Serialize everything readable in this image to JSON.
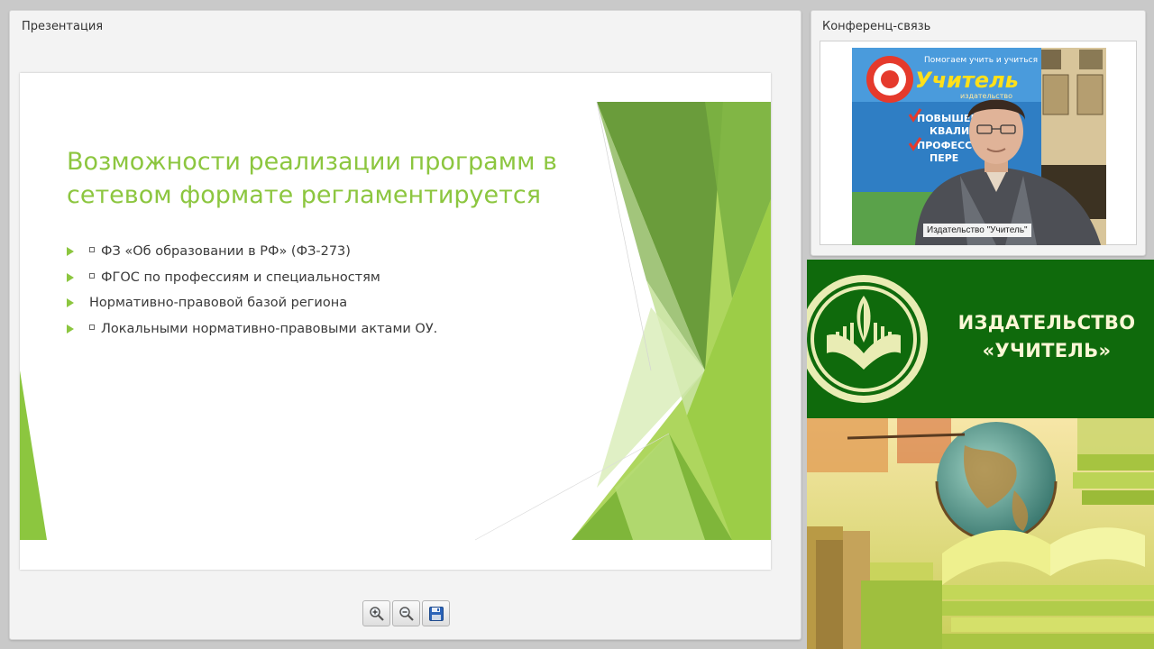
{
  "presentation": {
    "title": "Презентация",
    "slide": {
      "heading": "Возможности реализации программ в сетевом формате регламентируется",
      "bullets": [
        "ФЗ «Об образовании в РФ» (ФЗ-273)",
        "ФГОС по профессиям и специальностям",
        "Нормативно-правовой базой региона",
        "Локальными нормативно-правовыми актами ОУ."
      ],
      "accent_color": "#8cc63f"
    },
    "toolbar": {
      "zoom_in_icon": "zoom-in-icon",
      "zoom_out_icon": "zoom-out-icon",
      "save_icon": "save-icon"
    }
  },
  "conference": {
    "title": "Конференц-связь",
    "speaker_label": "Издательство \"Учитель\"",
    "backdrop_text": {
      "line1": "Помогаем учить и учиться",
      "brand": "Учитель",
      "sub": "издательство",
      "items": [
        "ПОВЫШЕНИЕ",
        "КВАЛИФ",
        "ПРОФЕСС",
        "ПЕРЕ"
      ]
    }
  },
  "publisher": {
    "name_line1": "ИЗДАТЕЛЬСТВО",
    "name_line2": "«УЧИТЕЛЬ»",
    "brand_color": "#0f6a0c"
  }
}
